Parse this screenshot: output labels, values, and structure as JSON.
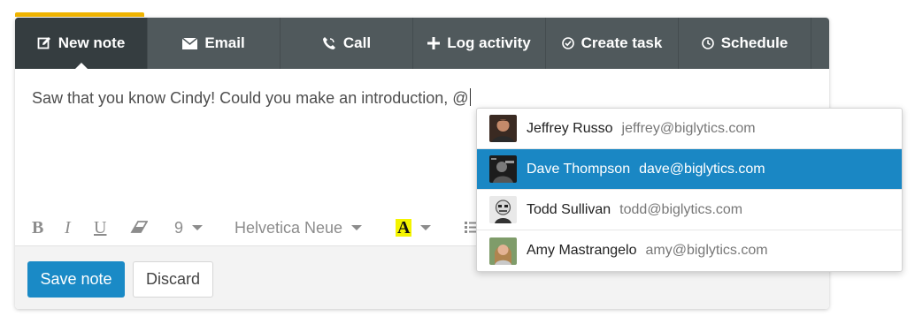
{
  "tabs": [
    {
      "label": "New note",
      "icon": "edit-icon",
      "active": true
    },
    {
      "label": "Email",
      "icon": "envelope-icon"
    },
    {
      "label": "Call",
      "icon": "phone-icon"
    },
    {
      "label": "Log activity",
      "icon": "plus-icon"
    },
    {
      "label": "Create task",
      "icon": "check-circle-icon"
    },
    {
      "label": "Schedule",
      "icon": "clock-icon"
    }
  ],
  "editor": {
    "text": "Saw that you know Cindy! Could you make an introduction, @"
  },
  "toolbar": {
    "bold": "B",
    "italic": "I",
    "underline": "U",
    "font_size": "9",
    "font_family": "Helvetica Neue",
    "highlight": "A"
  },
  "mentions": [
    {
      "name": "Jeffrey Russo",
      "email": "jeffrey@biglytics.com"
    },
    {
      "name": "Dave Thompson",
      "email": "dave@biglytics.com",
      "selected": true
    },
    {
      "name": "Todd Sullivan",
      "email": "todd@biglytics.com"
    },
    {
      "name": "Amy Mastrangelo",
      "email": "amy@biglytics.com"
    }
  ],
  "footer": {
    "save_label": "Save note",
    "discard_label": "Discard"
  },
  "colors": {
    "tabbar": "#50595c",
    "tab_active": "#353d40",
    "accent": "#f0b400",
    "primary": "#1a8ac6",
    "highlight": "#f4f400"
  }
}
